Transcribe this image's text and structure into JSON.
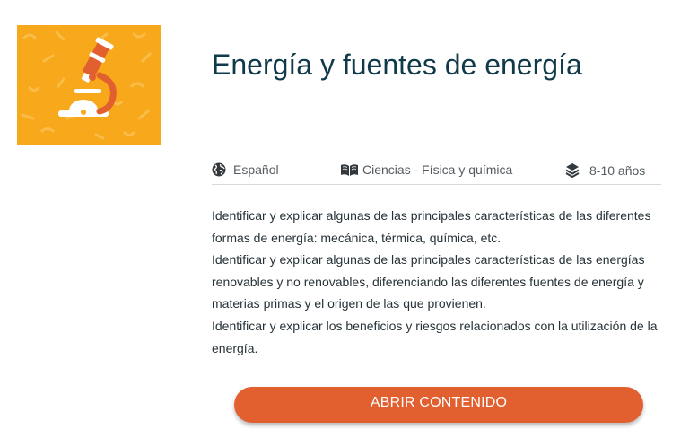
{
  "resource": {
    "title": "Energía y fuentes de energía",
    "thumbnail_icon": "microscope-icon",
    "thumbnail_color": "#f7a81b"
  },
  "meta": {
    "language": {
      "icon": "globe-icon",
      "label": "Español"
    },
    "subject": {
      "icon": "open-book-icon",
      "label": "Ciencias - Física y química"
    },
    "age": {
      "icon": "layers-icon",
      "label": "8-10 años"
    }
  },
  "description": [
    "Identificar y explicar algunas de las principales características de las diferentes formas de energía: mecánica, térmica, química, etc.",
    "Identificar y explicar algunas de las principales características de las energías renovables y no renovables, diferenciando las diferentes fuentes de energía y materias primas y el origen de las que provienen.",
    "Identificar y explicar los beneficios y riesgos relacionados con la utilización de la energía."
  ],
  "actions": {
    "open_label": "ABRIR CONTENIDO",
    "open_color": "#e2602f"
  }
}
